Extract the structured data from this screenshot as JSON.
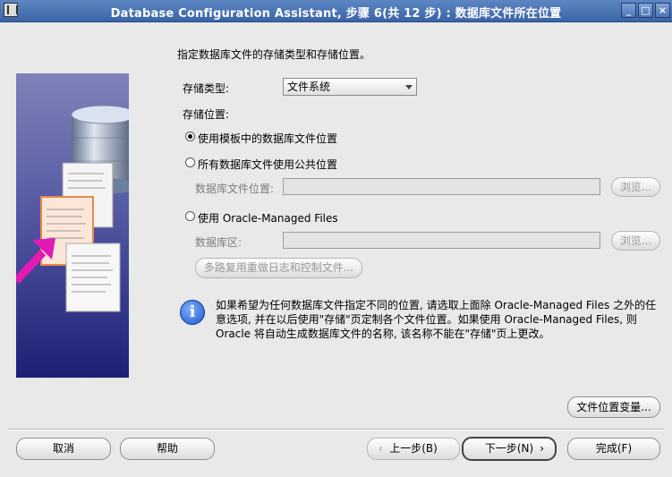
{
  "window": {
    "title": "Database Configuration Assistant, 步骤 6(共 12 步) : 数据库文件所在位置",
    "minimize": "_",
    "maximize": "□",
    "close": "×"
  },
  "main": {
    "heading": "指定数据库文件的存储类型和存储位置。",
    "storage_type_label": "存储类型:",
    "storage_type_value": "文件系统",
    "storage_location_label": "存储位置:",
    "options": {
      "template": "使用模板中的数据库文件位置",
      "common": "所有数据库文件使用公共位置",
      "db_file_location_label": "数据库文件位置:",
      "omf": "使用 Oracle-Managed Files",
      "db_area_label": "数据库区:",
      "browse": "浏览...",
      "multiplex": "多路复用重做日志和控制文件..."
    },
    "info": "如果希望为任何数据库文件指定不同的位置, 请选取上面除 Oracle-Managed Files 之外的任意选项, 并在以后使用\"存储\"页定制各个文件位置。如果使用 Oracle-Managed Files, 则 Oracle 将自动生成数据库文件的名称, 该名称不能在\"存储\"页上更改。",
    "file_location_vars": "文件位置变量..."
  },
  "footer": {
    "cancel": "取消",
    "help": "帮助",
    "back": "上一步(B)",
    "next": "下一步(N)",
    "finish": "完成(F)"
  }
}
